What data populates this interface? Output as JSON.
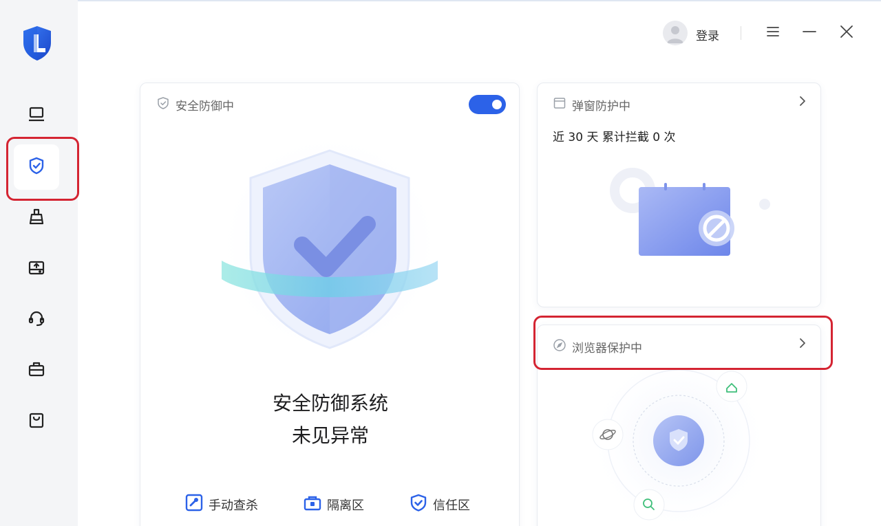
{
  "header": {
    "login_label": "登录"
  },
  "sidebar": {
    "items": [
      {
        "icon": "laptop-icon"
      },
      {
        "icon": "shield-check-icon",
        "active": true
      },
      {
        "icon": "broom-icon"
      },
      {
        "icon": "drive-upload-icon"
      },
      {
        "icon": "headset-icon"
      },
      {
        "icon": "toolbox-icon"
      },
      {
        "icon": "shopping-bag-icon"
      }
    ]
  },
  "main_card": {
    "title": "安全防御中",
    "toggle_on": true,
    "status_line1": "安全防御系统",
    "status_line2": "未见异常",
    "actions": [
      {
        "label": "手动查杀",
        "icon": "manual-scan-icon"
      },
      {
        "label": "隔离区",
        "icon": "quarantine-icon"
      },
      {
        "label": "信任区",
        "icon": "trust-zone-icon"
      }
    ]
  },
  "popup_card": {
    "title": "弹窗防护中",
    "stat": "近 30 天 累计拦截 0 次"
  },
  "browser_card": {
    "title": "浏览器保护中"
  },
  "colors": {
    "accent": "#2c62e8",
    "sidebar_bg": "#f4f5f7",
    "highlight": "#d42432"
  }
}
